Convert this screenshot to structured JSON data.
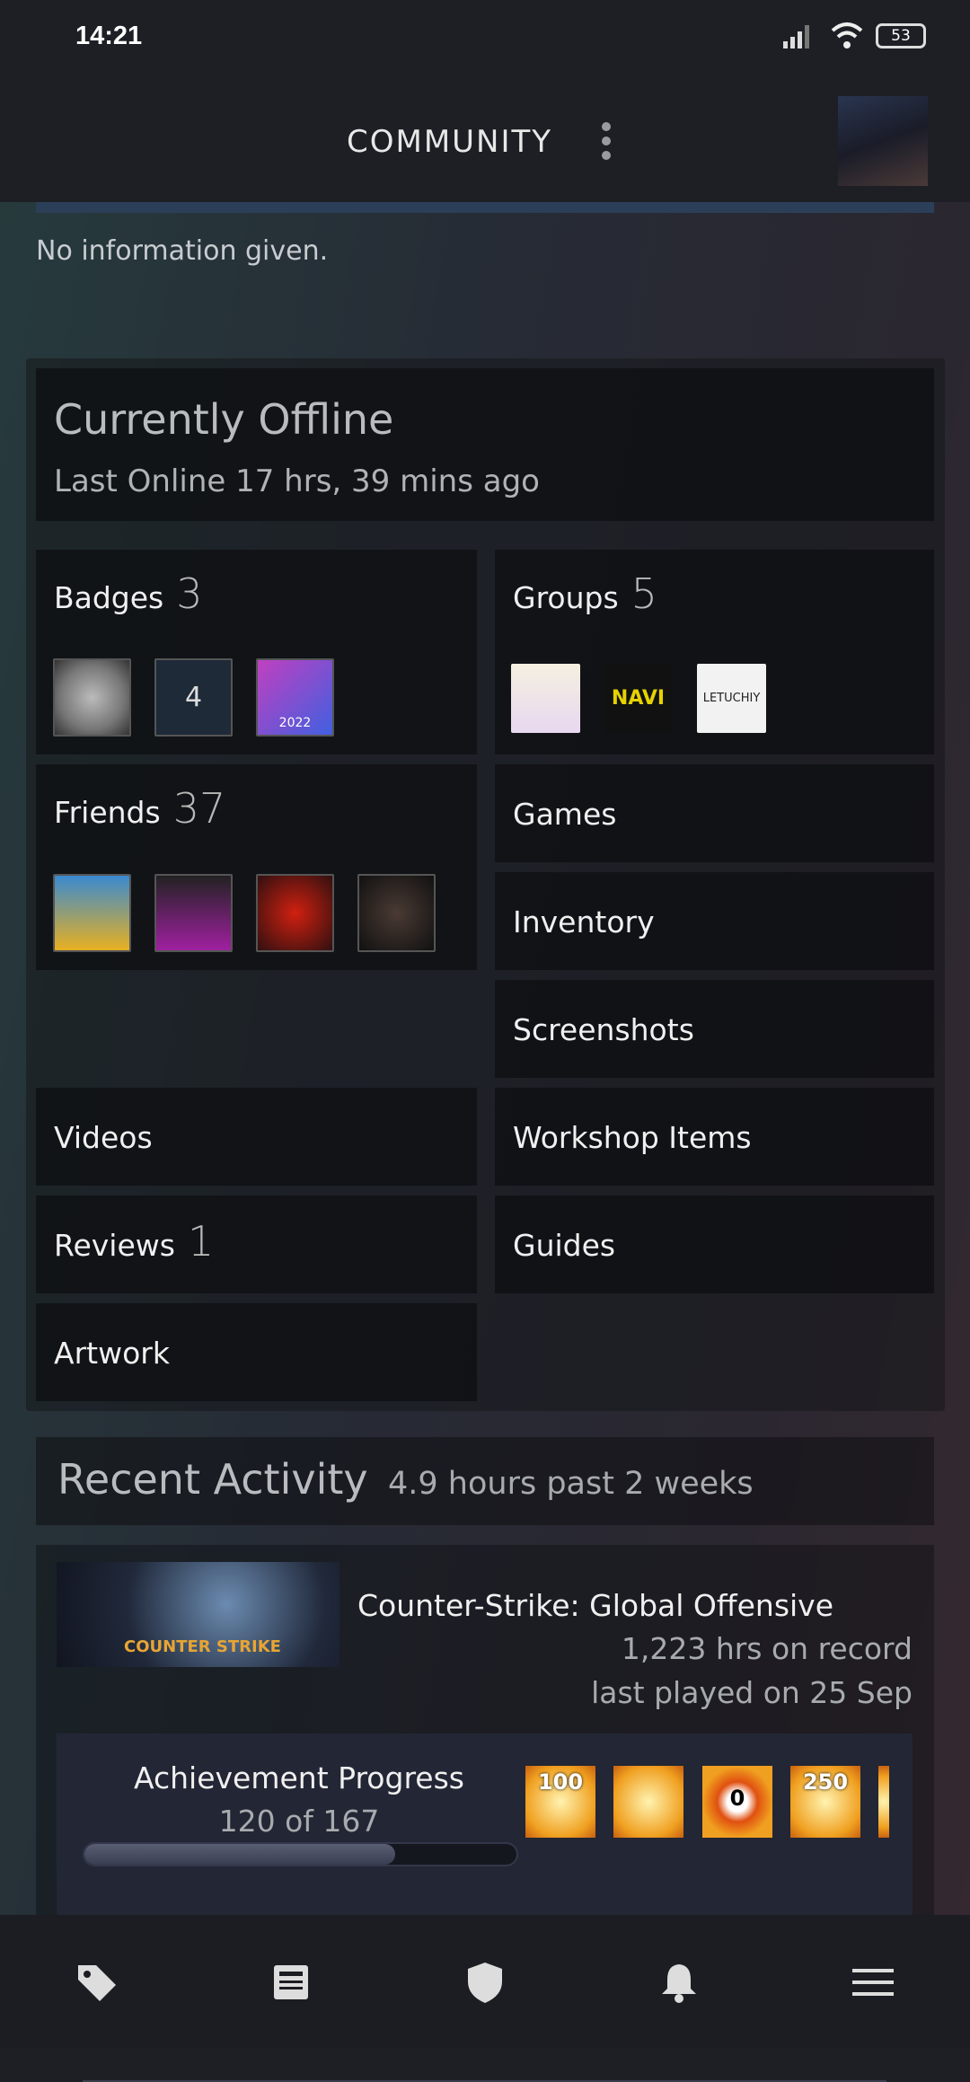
{
  "status_bar": {
    "time": "14:21",
    "battery": "53",
    "icons": [
      "signal-icon",
      "wifi-icon",
      "battery-icon"
    ]
  },
  "header": {
    "title": "COMMUNITY",
    "menu_icon": "more-vertical-icon",
    "avatar": "user-avatar"
  },
  "profile": {
    "summary": "No information given."
  },
  "status": {
    "title": "Currently Offline",
    "last_online": "Last Online 17 hrs, 39 mins ago"
  },
  "sections": {
    "badges": {
      "label": "Badges",
      "count": "3",
      "items": [
        "badge-1",
        "4",
        "2022"
      ]
    },
    "groups": {
      "label": "Groups",
      "count": "5",
      "items": [
        "group-anime",
        "NAVI",
        "LETUCHIY"
      ]
    },
    "friends": {
      "label": "Friends",
      "count": "37"
    },
    "games": {
      "label": "Games"
    },
    "inventory": {
      "label": "Inventory"
    },
    "screenshots": {
      "label": "Screenshots"
    },
    "videos": {
      "label": "Videos"
    },
    "workshop": {
      "label": "Workshop Items"
    },
    "reviews": {
      "label": "Reviews",
      "count": "1"
    },
    "guides": {
      "label": "Guides"
    },
    "artwork": {
      "label": "Artwork"
    }
  },
  "recent_activity": {
    "title": "Recent Activity",
    "hours": "4.9 hours past 2 weeks"
  },
  "game": {
    "name": "Counter-Strike: Global Offensive",
    "logo": "COUNTER STRIKE",
    "hours": "1,223 hrs on record",
    "last_played": "last played on 25 Sep",
    "achievements": {
      "title": "Achievement Progress",
      "progress_text": "120 of 167",
      "unlocked": 120,
      "total": 167,
      "icons": [
        "100",
        "",
        "0",
        "250",
        ""
      ]
    }
  },
  "bottom_nav": [
    "tag-icon",
    "news-icon",
    "shield-icon",
    "bell-icon",
    "menu-icon"
  ]
}
